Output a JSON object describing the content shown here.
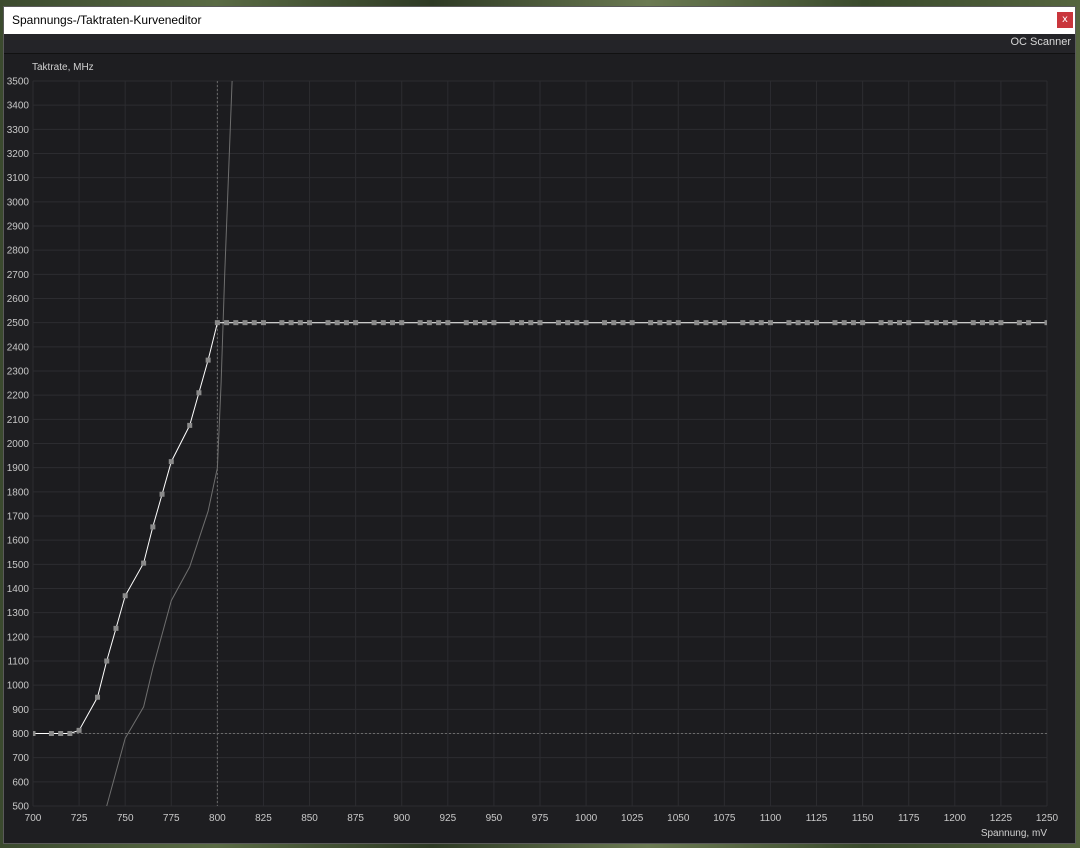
{
  "window": {
    "title": "Spannungs-/Taktraten-Kurveneditor",
    "close_label": "x"
  },
  "toolbar": {
    "oc_scanner_label": "OC Scanner"
  },
  "chart_data": {
    "type": "line",
    "ylabel": "Taktrate, MHz",
    "xlabel": "Spannung, mV",
    "xlim": [
      700,
      1250
    ],
    "ylim": [
      500,
      3500
    ],
    "x_ticks": [
      700,
      725,
      750,
      775,
      800,
      825,
      850,
      875,
      900,
      925,
      950,
      975,
      1000,
      1025,
      1050,
      1075,
      1100,
      1125,
      1150,
      1175,
      1200,
      1225,
      1250
    ],
    "y_ticks": [
      500,
      600,
      700,
      800,
      900,
      1000,
      1100,
      1200,
      1300,
      1400,
      1500,
      1600,
      1700,
      1800,
      1900,
      2000,
      2100,
      2200,
      2300,
      2400,
      2500,
      2600,
      2700,
      2800,
      2900,
      3000,
      3100,
      3200,
      3300,
      3400,
      3500
    ],
    "grid": true,
    "series": [
      {
        "color": "#ffffff",
        "markers": true,
        "points": [
          [
            700,
            800
          ],
          [
            710,
            800
          ],
          [
            715,
            800
          ],
          [
            720,
            800
          ],
          [
            725,
            813
          ],
          [
            735,
            950
          ],
          [
            740,
            1100
          ],
          [
            745,
            1235
          ],
          [
            750,
            1370
          ],
          [
            760,
            1505
          ],
          [
            765,
            1655
          ],
          [
            770,
            1790
          ],
          [
            775,
            1925
          ],
          [
            785,
            2075
          ],
          [
            790,
            2210
          ],
          [
            795,
            2345
          ],
          [
            800,
            2500
          ],
          [
            805,
            2500
          ],
          [
            810,
            2500
          ],
          [
            815,
            2500
          ],
          [
            820,
            2500
          ],
          [
            825,
            2500
          ],
          [
            835,
            2500
          ],
          [
            840,
            2500
          ],
          [
            845,
            2500
          ],
          [
            850,
            2500
          ],
          [
            860,
            2500
          ],
          [
            865,
            2500
          ],
          [
            870,
            2500
          ],
          [
            875,
            2500
          ],
          [
            885,
            2500
          ],
          [
            890,
            2500
          ],
          [
            895,
            2500
          ],
          [
            900,
            2500
          ],
          [
            910,
            2500
          ],
          [
            915,
            2500
          ],
          [
            920,
            2500
          ],
          [
            925,
            2500
          ],
          [
            935,
            2500
          ],
          [
            940,
            2500
          ],
          [
            945,
            2500
          ],
          [
            950,
            2500
          ],
          [
            960,
            2500
          ],
          [
            965,
            2500
          ],
          [
            970,
            2500
          ],
          [
            975,
            2500
          ],
          [
            985,
            2500
          ],
          [
            990,
            2500
          ],
          [
            995,
            2500
          ],
          [
            1000,
            2500
          ],
          [
            1010,
            2500
          ],
          [
            1015,
            2500
          ],
          [
            1020,
            2500
          ],
          [
            1025,
            2500
          ],
          [
            1035,
            2500
          ],
          [
            1040,
            2500
          ],
          [
            1045,
            2500
          ],
          [
            1050,
            2500
          ],
          [
            1060,
            2500
          ],
          [
            1065,
            2500
          ],
          [
            1070,
            2500
          ],
          [
            1075,
            2500
          ],
          [
            1085,
            2500
          ],
          [
            1090,
            2500
          ],
          [
            1095,
            2500
          ],
          [
            1100,
            2500
          ],
          [
            1110,
            2500
          ],
          [
            1115,
            2500
          ],
          [
            1120,
            2500
          ],
          [
            1125,
            2500
          ],
          [
            1135,
            2500
          ],
          [
            1140,
            2500
          ],
          [
            1145,
            2500
          ],
          [
            1150,
            2500
          ],
          [
            1160,
            2500
          ],
          [
            1165,
            2500
          ],
          [
            1170,
            2500
          ],
          [
            1175,
            2500
          ],
          [
            1185,
            2500
          ],
          [
            1190,
            2500
          ],
          [
            1195,
            2500
          ],
          [
            1200,
            2500
          ],
          [
            1210,
            2500
          ],
          [
            1215,
            2500
          ],
          [
            1220,
            2500
          ],
          [
            1225,
            2500
          ],
          [
            1235,
            2500
          ],
          [
            1240,
            2500
          ],
          [
            1250,
            2500
          ]
        ]
      },
      {
        "color": "#6e6e6e",
        "markers": false,
        "points": [
          [
            740,
            500
          ],
          [
            750,
            780
          ],
          [
            760,
            910
          ],
          [
            765,
            1070
          ],
          [
            775,
            1350
          ],
          [
            785,
            1490
          ],
          [
            795,
            1720
          ],
          [
            800,
            1900
          ],
          [
            802,
            2250
          ],
          [
            804,
            2700
          ],
          [
            806,
            3100
          ],
          [
            808,
            3500
          ]
        ]
      }
    ],
    "crosshair": {
      "x": 800,
      "y": 800
    }
  }
}
